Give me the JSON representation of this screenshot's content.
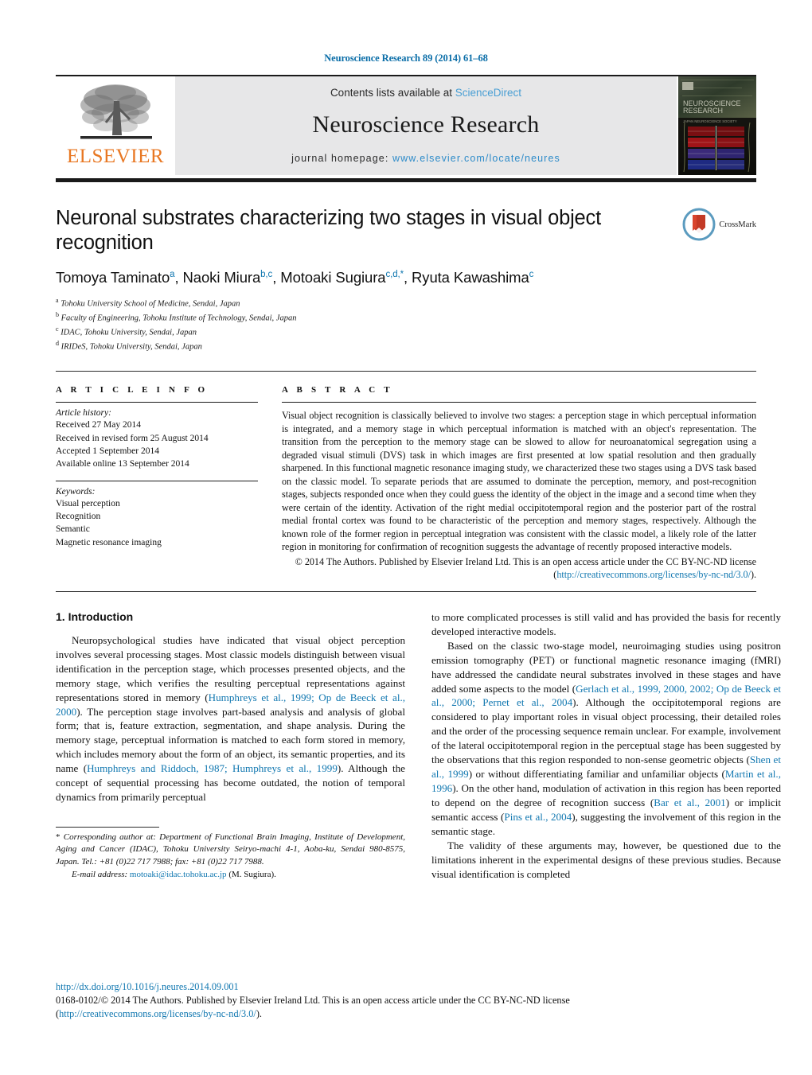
{
  "running_head": "Neuroscience Research 89 (2014) 61–68",
  "masthead": {
    "publisher_logo_label": "ELSEVIER",
    "contents_prefix": "Contents lists available at ",
    "contents_link": "ScienceDirect",
    "journal_name": "Neuroscience Research",
    "homepage_prefix": "journal homepage: ",
    "homepage_url": "www.elsevier.com/locate/neures",
    "cover_caption": "NEUROSCIENCE RESEARCH"
  },
  "title_block": {
    "title": "Neuronal substrates characterizing two stages in visual object recognition",
    "crossmark_label": "CrossMark",
    "authors_html": "Tomoya Taminato<sup>a</sup>, Naoki Miura<sup>b,c</sup>, Motoaki Sugiura<sup>c,d,*</sup>, Ryuta Kawashima<sup>c</sup>",
    "affiliations": [
      {
        "marker": "a",
        "text": "Tohoku University School of Medicine, Sendai, Japan"
      },
      {
        "marker": "b",
        "text": "Faculty of Engineering, Tohoku Institute of Technology, Sendai, Japan"
      },
      {
        "marker": "c",
        "text": "IDAC, Tohoku University, Sendai, Japan"
      },
      {
        "marker": "d",
        "text": "IRIDeS, Tohoku University, Sendai, Japan"
      }
    ]
  },
  "article_info": {
    "heading": "A R T I C L E   I N F O",
    "history_label": "Article history:",
    "history": [
      "Received 27 May 2014",
      "Received in revised form 25 August 2014",
      "Accepted 1 September 2014",
      "Available online 13 September 2014"
    ],
    "keywords_label": "Keywords:",
    "keywords": [
      "Visual perception",
      "Recognition",
      "Semantic",
      "Magnetic resonance imaging"
    ]
  },
  "abstract": {
    "heading": "A B S T R A C T",
    "text": "Visual object recognition is classically believed to involve two stages: a perception stage in which perceptual information is integrated, and a memory stage in which perceptual information is matched with an object's representation. The transition from the perception to the memory stage can be slowed to allow for neuroanatomical segregation using a degraded visual stimuli (DVS) task in which images are first presented at low spatial resolution and then gradually sharpened. In this functional magnetic resonance imaging study, we characterized these two stages using a DVS task based on the classic model. To separate periods that are assumed to dominate the perception, memory, and post-recognition stages, subjects responded once when they could guess the identity of the object in the image and a second time when they were certain of the identity. Activation of the right medial occipitotemporal region and the posterior part of the rostral medial frontal cortex was found to be characteristic of the perception and memory stages, respectively. Although the known role of the former region in perceptual integration was consistent with the classic model, a likely role of the latter region in monitoring for confirmation of recognition suggests the advantage of recently proposed interactive models.",
    "copyright_prefix": "© 2014 The Authors. Published by Elsevier Ireland Ltd. This is an open access article under the CC BY-NC-ND license (",
    "copyright_link": "http://creativecommons.org/licenses/by-nc-nd/3.0/",
    "copyright_suffix": ")."
  },
  "introduction": {
    "heading": "1. Introduction",
    "left_paragraphs": [
      {
        "parts": [
          {
            "t": "Neuropsychological studies have indicated that visual object perception involves several processing stages. Most classic models distinguish between visual identification in the perception stage, which processes presented objects, and the memory stage, which verifies the resulting perceptual representations against representations stored in memory (",
            "k": "plain"
          },
          {
            "t": "Humphreys et al., 1999; Op de Beeck et al., 2000",
            "k": "link"
          },
          {
            "t": "). The perception stage involves part-based analysis and analysis of global form; that is, feature extraction, segmentation, and shape analysis. During the memory stage, perceptual information is matched to each form stored in memory, which includes memory about the form of an object, its semantic properties, and its name (",
            "k": "plain"
          },
          {
            "t": "Humphreys and Riddoch, 1987; Humphreys et al., 1999",
            "k": "link"
          },
          {
            "t": "). Although the concept of sequential processing has become outdated, the notion of temporal dynamics from primarily perceptual",
            "k": "plain"
          }
        ]
      }
    ],
    "right_paragraphs": [
      {
        "indent": false,
        "parts": [
          {
            "t": "to more complicated processes is still valid and has provided the basis for recently developed interactive models.",
            "k": "plain"
          }
        ]
      },
      {
        "indent": true,
        "parts": [
          {
            "t": "Based on the classic two-stage model, neuroimaging studies using positron emission tomography (PET) or functional magnetic resonance imaging (fMRI) have addressed the candidate neural substrates involved in these stages and have added some aspects to the model (",
            "k": "plain"
          },
          {
            "t": "Gerlach et al., 1999, 2000, 2002; Op de Beeck et al., 2000; Pernet et al., 2004",
            "k": "link"
          },
          {
            "t": "). Although the occipitotemporal regions are considered to play important roles in visual object processing, their detailed roles and the order of the processing sequence remain unclear. For example, involvement of the lateral occipitotemporal region in the perceptual stage has been suggested by the observations that this region responded to non-sense geometric objects (",
            "k": "plain"
          },
          {
            "t": "Shen et al., 1999",
            "k": "link"
          },
          {
            "t": ") or without differentiating familiar and unfamiliar objects (",
            "k": "plain"
          },
          {
            "t": "Martin et al., 1996",
            "k": "link"
          },
          {
            "t": "). On the other hand, modulation of activation in this region has been reported to depend on the degree of recognition success (",
            "k": "plain"
          },
          {
            "t": "Bar et al., 2001",
            "k": "link"
          },
          {
            "t": ") or implicit semantic access (",
            "k": "plain"
          },
          {
            "t": "Pins et al., 2004",
            "k": "link"
          },
          {
            "t": "), suggesting the involvement of this region in the semantic stage.",
            "k": "plain"
          }
        ]
      },
      {
        "indent": true,
        "parts": [
          {
            "t": "The validity of these arguments may, however, be questioned due to the limitations inherent in the experimental designs of these previous studies. Because visual identification is completed",
            "k": "plain"
          }
        ]
      }
    ]
  },
  "footnote": {
    "star": "*",
    "corresponding_text": "Corresponding author at: Department of Functional Brain Imaging, Institute of Development, Aging and Cancer (IDAC), Tohoku University Seiryo-machi 4-1, Aoba-ku, Sendai 980-8575, Japan. Tel.: +81 (0)22 717 7988; fax: +81 (0)22 717 7988.",
    "email_label": "E-mail address:",
    "email": "motoaki@idac.tohoku.ac.jp",
    "email_suffix": "(M. Sugiura)."
  },
  "license_footer": {
    "doi": "http://dx.doi.org/10.1016/j.neures.2014.09.001",
    "line1": "0168-0102/© 2014 The Authors. Published by Elsevier Ireland Ltd. This is an open access article under the CC BY-NC-ND license",
    "line2_open": "(",
    "line2_link": "http://creativecommons.org/licenses/by-nc-nd/3.0/",
    "line2_close": ")."
  },
  "colors": {
    "link": "#1077b0",
    "running_head": "#0b6ea8",
    "elsevier_orange": "#E87722",
    "sciencedirect": "#4a9fd4",
    "masthead_bg": "#e7e7e8"
  }
}
